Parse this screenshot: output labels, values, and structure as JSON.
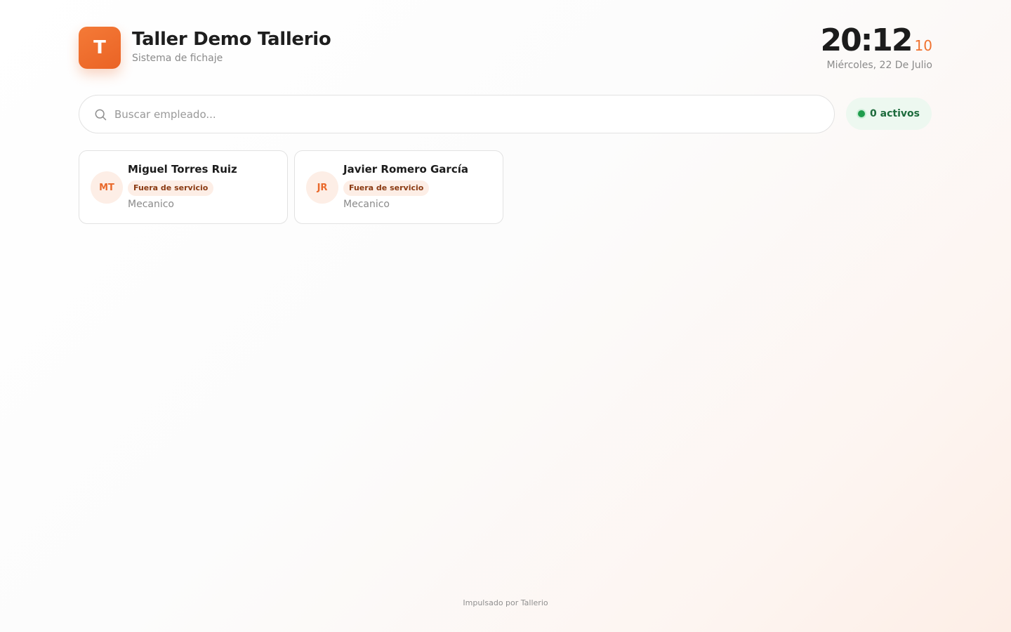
{
  "app": {
    "logo_letter": "T",
    "title": "Taller Demo Tallerio",
    "subtitle": "Sistema de fichaje"
  },
  "clock": {
    "hours_minutes": "20:12",
    "seconds": "10",
    "date": "Miércoles, 22 De Julio"
  },
  "search": {
    "placeholder": "Buscar empleado...",
    "value": ""
  },
  "active_badge": {
    "label": "0 activos"
  },
  "employees": [
    {
      "initials": "MT",
      "name": "Miguel Torres Ruiz",
      "status": "Fuera de servicio",
      "role": "Mecanico"
    },
    {
      "initials": "JR",
      "name": "Javier Romero García",
      "status": "Fuera de servicio",
      "role": "Mecanico"
    }
  ],
  "footer": {
    "text": "Impulsado por Tallerio"
  },
  "colors": {
    "accent": "#f07230",
    "active_green": "#1f9d4d",
    "status_bg": "#fdeee6"
  }
}
